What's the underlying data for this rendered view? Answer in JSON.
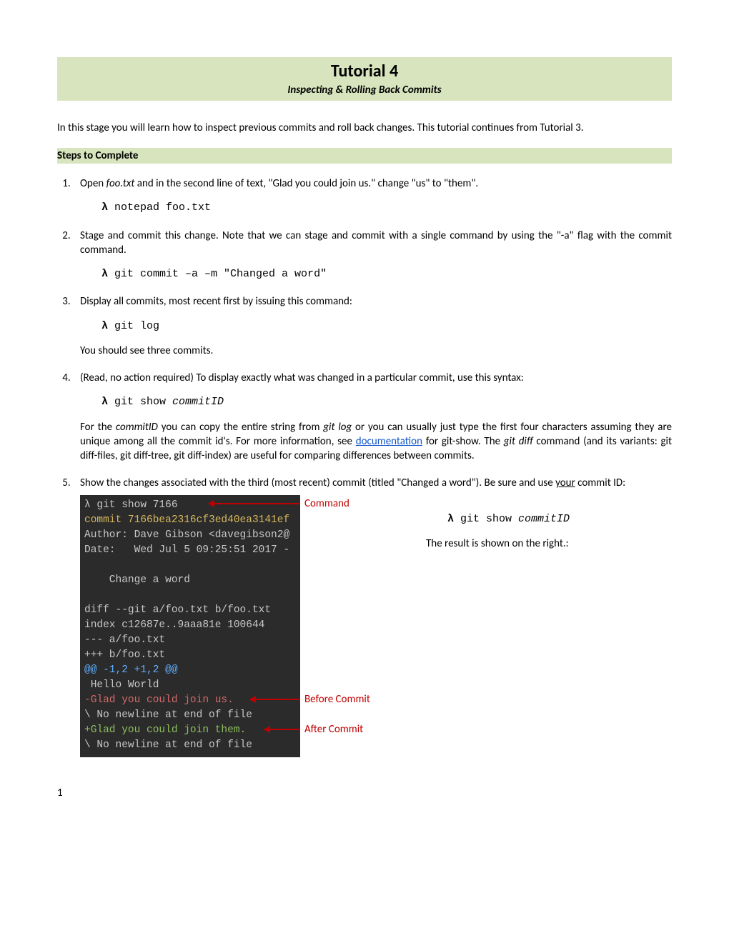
{
  "title": "Tutorial 4",
  "subtitle": "Inspecting & Rolling Back Commits",
  "intro": "In this stage you will learn how to inspect previous commits and roll back changes. This tutorial continues from Tutorial 3.",
  "section_header": "Steps to Complete",
  "steps": {
    "s1": {
      "pre": "Open ",
      "file": "foo.txt",
      "post": " and in the second line of text, \"Glad you could join us.\" change \"us\" to \"them\".",
      "cmd_lambda": "λ",
      "cmd": " notepad foo.txt"
    },
    "s2": {
      "text": "Stage and commit this change. Note that we can stage and commit with a single command by using the \"-a\" flag with the commit command.",
      "cmd_lambda": "λ",
      "cmd": " git commit –a –m \"Changed a word\""
    },
    "s3": {
      "text": "Display all commits, most recent first by issuing this command:",
      "cmd_lambda": "λ",
      "cmd": " git log",
      "note": "You should see three commits."
    },
    "s4": {
      "text": "(Read, no action required) To display exactly what was changed in a particular commit, use this syntax:",
      "cmd_lambda": "λ",
      "cmd_a": " git show ",
      "cmd_b": "commitID",
      "para_a": "For the ",
      "para_b": "commitID",
      "para_c": " you can copy the entire string from ",
      "para_d": "git log",
      "para_e": " or you can usually just type the first four characters assuming they are unique among all the commit id's. For more information, see ",
      "link": "documentation",
      "para_f": " for git-show. The ",
      "para_g": "git diff",
      "para_h": " command (and its variants: git diff-files, git diff-tree, git diff-index) are useful for comparing differences between commits."
    },
    "s5": {
      "text_a": "Show the changes associated with the third (most recent) commit (titled \"Changed a word\"). Be sure and use ",
      "text_b": "your",
      "text_c": " commit ID:",
      "cmd_lambda": "λ",
      "cmd_a": " git show ",
      "cmd_b": "commitID",
      "result": "The result is shown on the right.:"
    }
  },
  "terminal": {
    "l1a": "λ",
    "l1b": " git show 7166",
    "l2": "commit 7166bea2316cf3ed40ea3141ef",
    "l3": "Author: Dave Gibson <davegibson2@",
    "l4": "Date:   Wed Jul 5 09:25:51 2017 -",
    "l5": "    Change a word",
    "l6": "diff --git a/foo.txt b/foo.txt",
    "l7": "index c12687e..9aaa81e 100644",
    "l8": "--- a/foo.txt",
    "l9": "+++ b/foo.txt",
    "l10": "@@ -1,2 +1,2 @@",
    "l11": " Hello World",
    "l12": "-Glad you could join us.",
    "l13": "\\ No newline at end of file",
    "l14": "+Glad you could join them.",
    "l15": "\\ No newline at end of file"
  },
  "annotations": {
    "command": "Command",
    "before": "Before Commit",
    "after": "After Commit"
  },
  "page_number": "1"
}
